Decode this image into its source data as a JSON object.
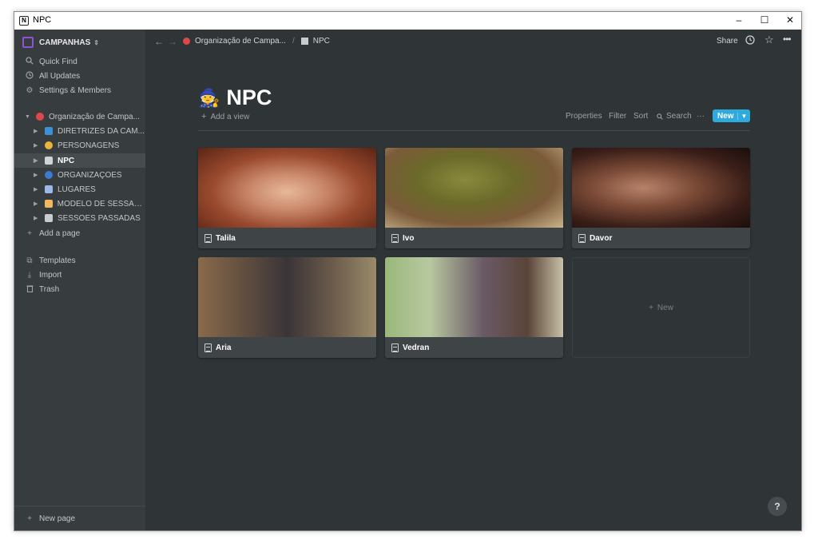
{
  "window": {
    "title": "NPC",
    "app_icon": "N",
    "minimize": "–",
    "maximize": "☐",
    "close": "✕"
  },
  "sidebar": {
    "workspace": "CAMPANHAS",
    "top_items": [
      {
        "label": "Quick Find",
        "icon": "search-icon"
      },
      {
        "label": "All Updates",
        "icon": "clock-icon"
      },
      {
        "label": "Settings & Members",
        "icon": "gear-icon"
      }
    ],
    "tree": [
      {
        "label": "Organização de Campa...",
        "icon_color": "#e0474c"
      },
      {
        "label": "DIRETRIZES DA CAM...",
        "icon_color": "#3d8fd8"
      },
      {
        "label": "PERSONAGENS",
        "icon_color": "#e8b53a"
      },
      {
        "label": "NPC",
        "icon_color": "#d0d4d8"
      },
      {
        "label": "ORGANIZAÇÕES",
        "icon_color": "#3d7bd0"
      },
      {
        "label": "LUGARES",
        "icon_color": "#9cb8e6"
      },
      {
        "label": "MODELO DE SESSÃO ...",
        "icon_color": "#f0b860"
      },
      {
        "label": "SESSÕES PASSADAS",
        "icon_color": "#c8ccd0"
      }
    ],
    "add_page": "Add a page",
    "bottom_items": [
      {
        "label": "Templates",
        "icon": "templates-icon"
      },
      {
        "label": "Import",
        "icon": "import-icon"
      },
      {
        "label": "Trash",
        "icon": "trash-icon"
      }
    ],
    "new_page": "New page"
  },
  "topbar": {
    "breadcrumb": [
      {
        "label": "Organização de Campa..."
      },
      {
        "label": "NPC"
      }
    ],
    "separator": "/",
    "share": "Share"
  },
  "page": {
    "title": "NPC",
    "add_view": "Add a view",
    "toolbar": {
      "properties": "Properties",
      "filter": "Filter",
      "sort": "Sort",
      "search": "Search",
      "more": "···",
      "new": "New"
    },
    "cards": [
      {
        "name": "Talila"
      },
      {
        "name": "Ivo"
      },
      {
        "name": "Davor"
      },
      {
        "name": "Aria"
      },
      {
        "name": "Vedran"
      }
    ],
    "new_card": "New"
  },
  "help": "?"
}
